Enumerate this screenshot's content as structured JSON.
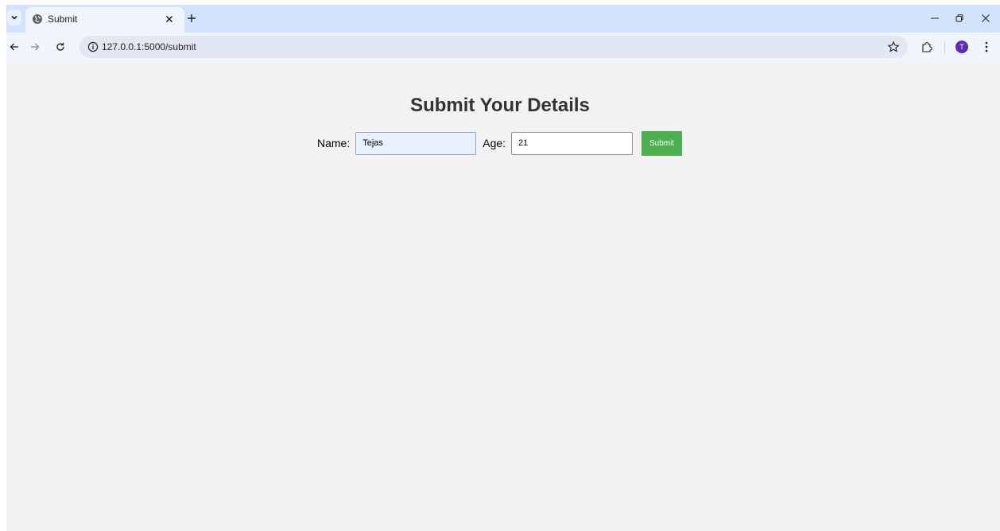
{
  "browser": {
    "tab_title": "Submit",
    "url": "127.0.0.1:5000/submit",
    "avatar_initial": "T",
    "icons": {
      "tab_search": "chevron-down-icon",
      "favicon": "globe-icon",
      "tab_close": "close-icon",
      "new_tab": "plus-icon",
      "minimize": "minimize-icon",
      "restore": "restore-icon",
      "window_close": "close-icon",
      "back": "arrow-left-icon",
      "forward": "arrow-right-icon",
      "reload": "reload-icon",
      "site_info": "info-icon",
      "bookmark": "star-icon",
      "extensions": "puzzle-icon",
      "menu": "kebab-menu-icon"
    },
    "colors": {
      "tabstrip": "#d3e3fd",
      "toolbar": "#f0f4fb",
      "avatar": "#5b2bb5"
    }
  },
  "page": {
    "title": "Submit Your Details",
    "form": {
      "name_label": "Name:",
      "name_value": "Tejas",
      "age_label": "Age:",
      "age_value": "21",
      "submit_label": "Submit"
    },
    "colors": {
      "background": "#f2f2f2",
      "submit_button": "#4caf50",
      "name_field_autofill": "#e8f0fe"
    }
  }
}
